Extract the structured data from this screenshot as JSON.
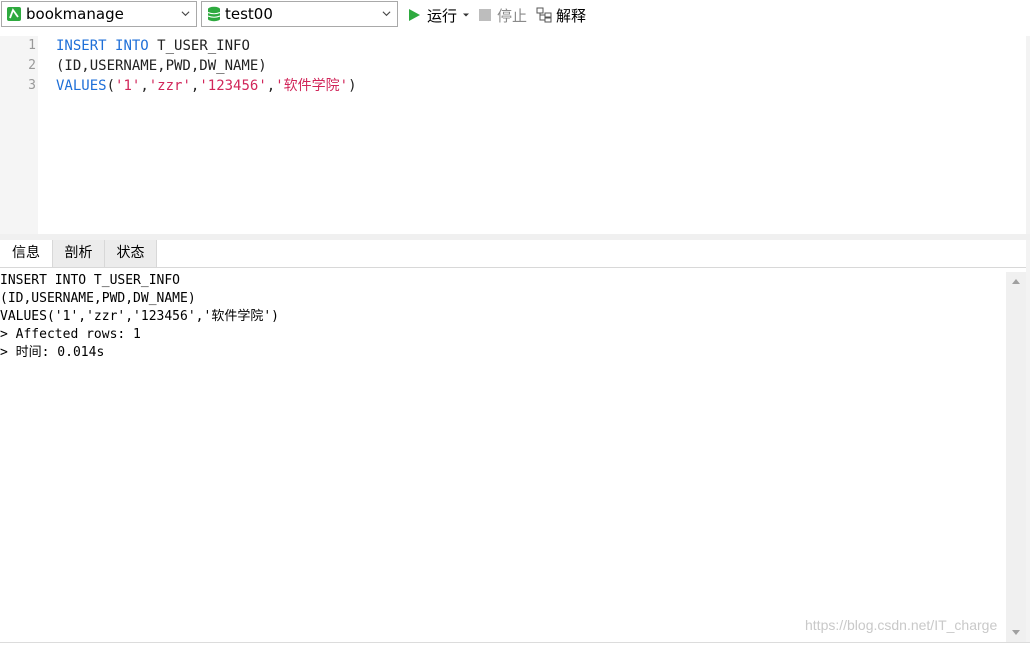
{
  "toolbar": {
    "connection_value": "bookmanage",
    "database_value": "test00",
    "run_label": "运行",
    "stop_label": "停止",
    "explain_label": "解释",
    "accent_run": "#2eaa3f"
  },
  "editor": {
    "line_numbers": [
      "1",
      "2",
      "3"
    ],
    "lines": [
      {
        "kw1": "INSERT",
        "kw2": "INTO",
        "rest": "T_USER_INFO"
      },
      {
        "text": "(ID,USERNAME,PWD,DW_NAME)"
      },
      {
        "kw": "VALUES",
        "open": "(",
        "s1": "'1'",
        "c1": ",",
        "s2": "'zzr'",
        "c2": ",",
        "s3": "'123456'",
        "c3": ",",
        "s4": "'软件学院'",
        "close": ")"
      }
    ]
  },
  "tabs": [
    "信息",
    "剖析",
    "状态"
  ],
  "output": {
    "lines": [
      "INSERT INTO T_USER_INFO",
      "(ID,USERNAME,PWD,DW_NAME)",
      "VALUES('1','zzr','123456','软件学院')",
      "> Affected rows: 1",
      "> 时间: 0.014s"
    ]
  },
  "watermark": "https://blog.csdn.net/IT_charge"
}
